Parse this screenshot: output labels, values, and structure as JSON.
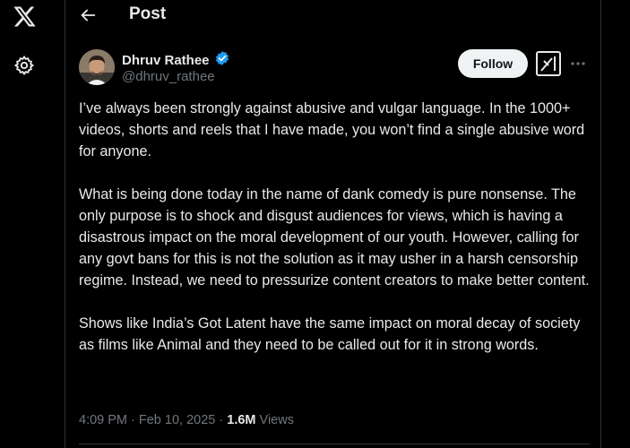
{
  "colors": {
    "background": "#000000",
    "text": "#e7e9ea",
    "muted": "#71767b",
    "verified": "#1d9bf0",
    "follow_bg": "#eff3f4"
  },
  "rail": {
    "logo_icon": "x-logo-icon",
    "settings_icon": "gear-icon"
  },
  "header": {
    "back_icon": "arrow-left-icon",
    "title": "Post"
  },
  "author": {
    "name": "Dhruv Rathee",
    "handle": "@dhruv_rathee",
    "verified_icon": "verified-badge-icon"
  },
  "actions": {
    "follow_label": "Follow",
    "grok_icon": "grok-icon",
    "more_icon": "more-horizontal-icon"
  },
  "post": {
    "paragraphs": [
      "I’ve always been strongly against abusive and vulgar language. In the 1000+ videos, shorts and reels that I have made, you won’t find a single abusive word for anyone.",
      "What is being done today in the name of dank comedy is pure nonsense. The only purpose is to shock and disgust audiences for views, which is having a disastrous impact on the moral development of our youth. However, calling for any govt bans for this is not the solution as it may usher in a harsh censorship regime. Instead, we need to pressurize content creators to make better content.",
      "Shows like India’s Got Latent have the same impact on moral decay of society as films like Animal and they need to be called out for it in strong words."
    ],
    "time": "4:09 PM",
    "separator": " · ",
    "date": "Feb 10, 2025",
    "views_count": "1.6M",
    "views_label": " Views"
  }
}
